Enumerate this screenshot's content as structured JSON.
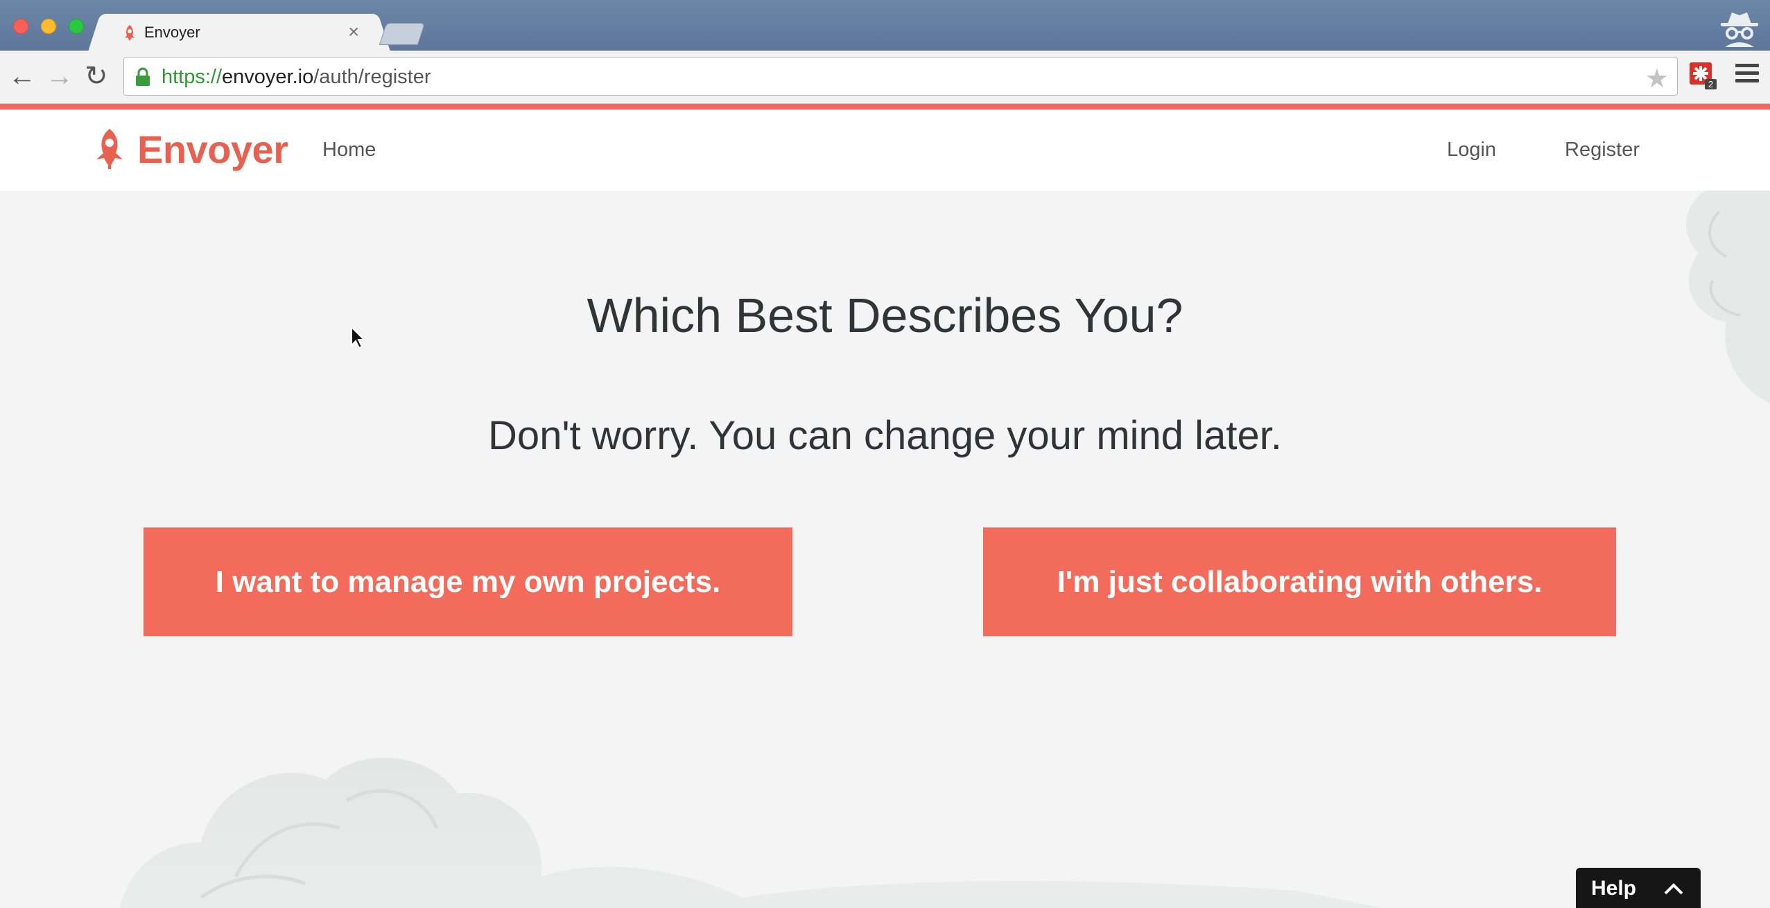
{
  "browser": {
    "tab_title": "Envoyer",
    "tab_close": "×",
    "url_scheme": "https://",
    "url_host": "envoyer.io",
    "url_path": "/auth/register",
    "back_glyph": "←",
    "forward_glyph": "→",
    "reload_glyph": "↻",
    "star_glyph": "★",
    "extension_badge": "2"
  },
  "site": {
    "brand_name": "Envoyer",
    "nav": {
      "home": "Home",
      "login": "Login",
      "register": "Register"
    }
  },
  "main": {
    "heading": "Which Best Describes You?",
    "subheading": "Don't worry. You can change your mind later.",
    "choices": [
      "I want to manage my own projects.",
      "I'm just collaborating with others."
    ]
  },
  "help_widget": {
    "label": "Help"
  },
  "colors": {
    "accent": "#ef675a",
    "button": "#f26b5b",
    "brand": "#e8604f",
    "background": "#f3f4f3"
  },
  "icons": [
    "lock-icon",
    "star-icon",
    "extension-icon",
    "menu-icon",
    "rocket-logo-icon",
    "incognito-icon",
    "cursor-icon",
    "chevron-up-icon"
  ]
}
